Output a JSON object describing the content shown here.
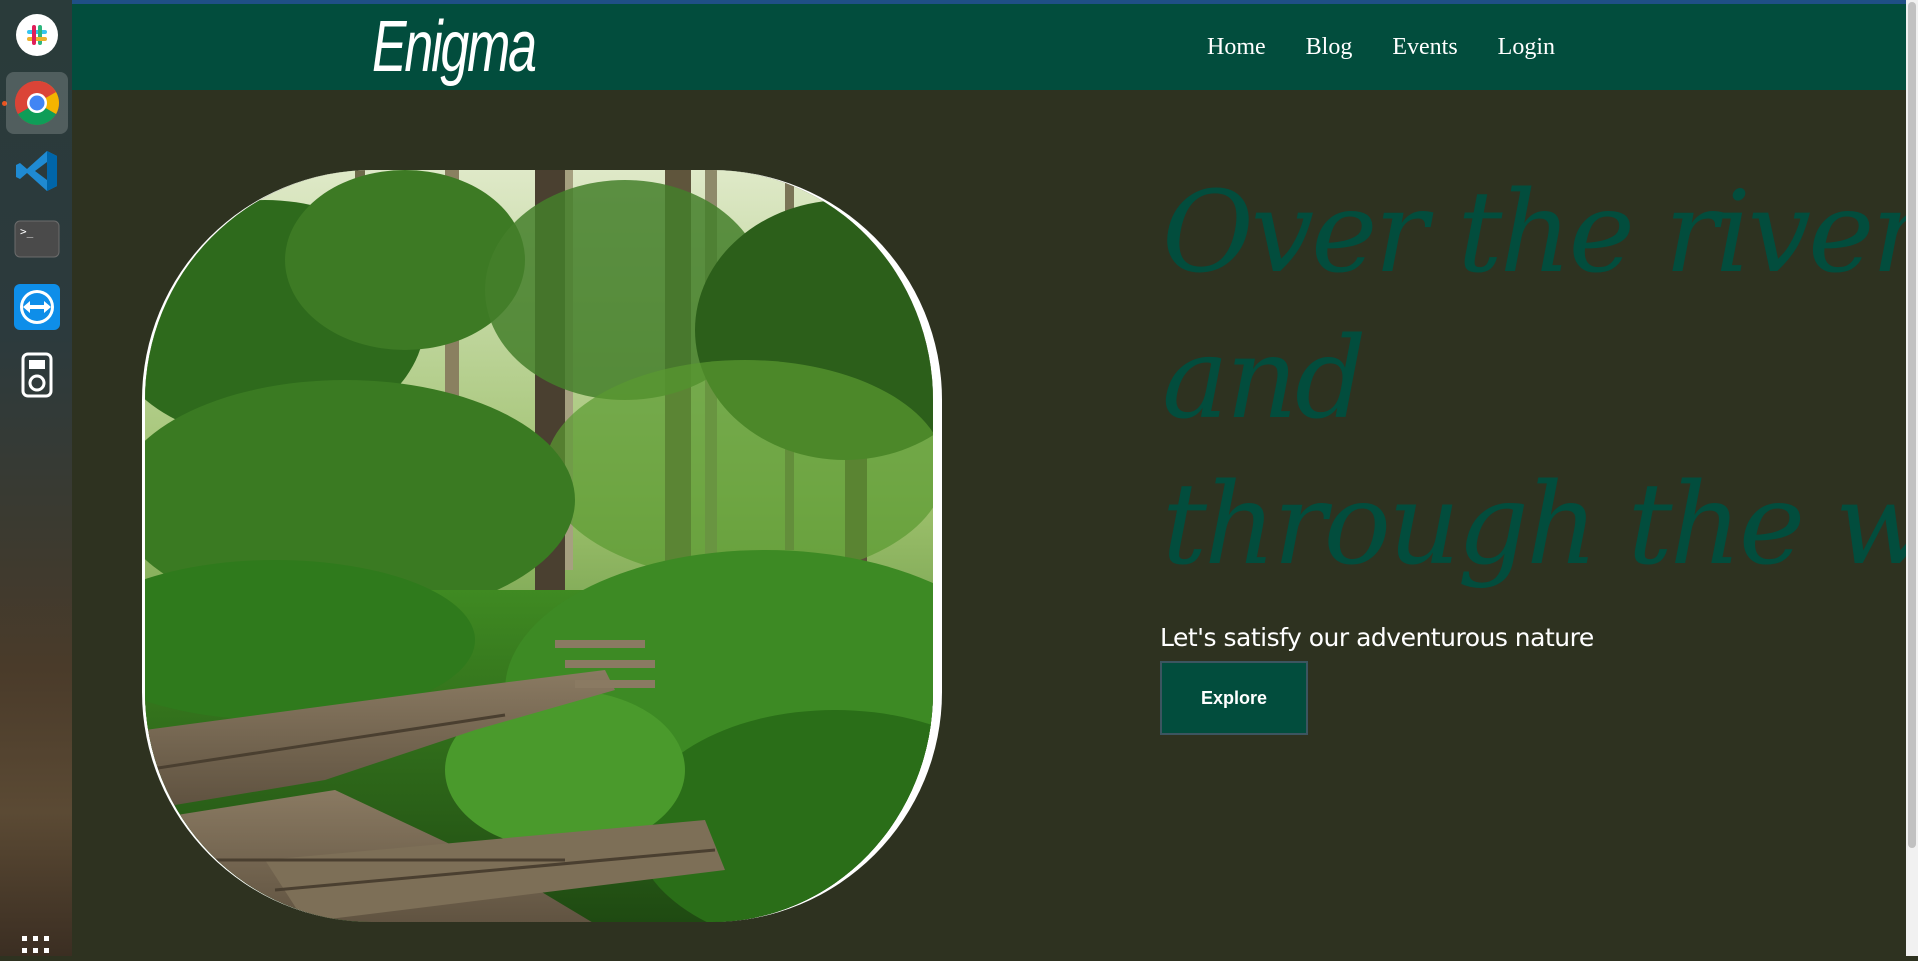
{
  "dock": {
    "apps": [
      {
        "name": "Slack",
        "icon": "slack-icon"
      },
      {
        "name": "Google Chrome",
        "icon": "chrome-icon",
        "active": true
      },
      {
        "name": "Visual Studio Code",
        "icon": "vscode-icon"
      },
      {
        "name": "Terminal",
        "icon": "terminal-icon",
        "glyph": ">_"
      },
      {
        "name": "TeamViewer",
        "icon": "teamviewer-icon"
      },
      {
        "name": "Music Player",
        "icon": "ipod-icon"
      }
    ],
    "show_apps_icon": "apps-grid-icon"
  },
  "site": {
    "brand": "Enigma",
    "nav": {
      "home": "Home",
      "blog": "Blog",
      "events": "Events",
      "login": "Login"
    },
    "hero": {
      "image_icon": "forest-boardwalk-image",
      "headline": {
        "line1": "Over the river",
        "line2": "and",
        "line3": "through the woods."
      },
      "tagline": "Let's satisfy our adventurous nature",
      "cta_label": "Explore"
    }
  },
  "colors": {
    "navbar": "#024d3d",
    "background": "#2e3220",
    "headline": "#024d3d",
    "button": "#024d3d",
    "text": "#ffffff"
  }
}
